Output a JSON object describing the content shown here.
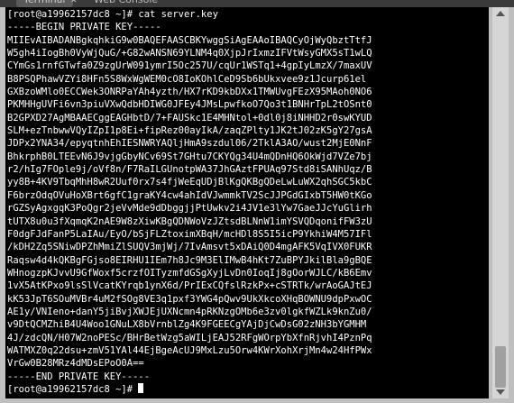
{
  "tabs": [
    {
      "label": "Terminal",
      "active": true
    },
    {
      "label": "Web Console",
      "active": false
    }
  ],
  "terminal": {
    "prompt_command": "[root@a19962157dc8 ~]# cat server.key",
    "key_lines": [
      "-----BEGIN PRIVATE KEY-----",
      "MIIEvAIBADANBgkqhkiG9w0BAQEFAASCBKYwggSiAgEAAoIBAQCyOjWyQbztTtfJ",
      "W5gh4iIogBh0VyWjQuG/+G82wANSN69YLNM4q0XjpJrIxmzIFVtWsyGMX5sT1wLQ",
      "CYmGs1rnfGTwfa0Z9zgUrW091ymrI5Oc257U/cqUr1WSTq1+4gpIyLmzX/7maxUV",
      "B8PSQPhawVZYi8HFn5S8WxWgWEM0cO8IoKOhlCeD9Sb6bUkxvee9z1Jcurp61el",
      "GXBzoWMlo0ECCWek3ONRPaYAh4yzth/HX7rKD9kbDXx1TMWUvgFEzX95MAoh0NO6",
      "PKMHHgUVFi6vn3piuVXwQdbHDIWG0JFEy4JMsLpwfkoO7Qo3t1BNHrTpL2tOSnt0",
      "B2GPXD27AgMBAAECggEAGHbtD/7+FAUSkc1E4MHNtol+0dl0j8iNHHD2r0swKYUD",
      "SLM+ezTnbwwVQyIZpI1p8Ei+fipRez00ayIkA/zaqZPlty1JK2tJ02zK5gY27gsA",
      "JDPx2YNA34/epyqtnhEhIESNWRYAQljHmA9szdul06/2TklA3AO/wust2MjE0NnF",
      "BhkrphB0LTEEvN6J9vjgGbyNCv69St7GHtu7CKYQg34U4mQDnHQ6OkWjd7VZe7bj",
      "r2/hIg7FOple9j/oVf8n/F7RaILGUnotpWA37JhGAztFPUAq97Std8iSANhUqz/B",
      "yy8B+4KV9TbqMhH8wR2Uuf0rx7s4fjWeEqUDjBlKgQKBgQDeLwLuWX2qhSGC5kbC",
      "F6brzOdqOVuHoXBrt6gfC1graKY4cw4ahIdVJwmmkTV2ScJJPGdGIxbT5HW0tKGo",
      "rGZSyAgxgqK3PoQgr2jeVvMde9dDbggjjPtUwkv2i4JV1e3lYw7GaeJJcYuGlirh",
      "tUTX8u0u3fXqmqK2nAE9W8zXiwKBgQDNWoVzJZtsdBLNnW1imYSVQDqonifFW3zU",
      "F0dgFJdFanP5LaIAu/EyO/bSjFLZtoximXBqH/mcHDl8S5I5icP9YkhiW4M57IFl",
      "/kDH2Zq5SNiwDPZhMmiZlSUQV3mjWj/7IvAmsvt5xDAiQ0D4mgAFK5VqIVX0FUKR",
      "Raqsw4d4kQKBgFGjso8EIRHU1IEm7h8Jc9M3ElIMwB4hKt7ZuBPYJkilBla9gBQE",
      "WHnogzpKJvvU9GfWoxf5crzfOITyzmfdGSgXyjLvDn0IoqIj8gOorWJLC/kB6Emv",
      "1vX5AtKPxo9lsSlVcatKYrqb1ynX6d/PrIExCQfslRzkPx+cSTRTk/wrAoGAJtEJ",
      "kK53JpT6SOuMVBr4uM2fSOg8VE3q1pxf3YWG4pQwv9UkXkcoXHqBOWNU9dpPxwOC",
      "AE1y/VNIeno+danY5jiBvjXWJEjUXNcmn4pRKNzgOMb6e3zv0lgkfWZLk9knZu0/",
      "v9DtQCMZhiB4U4Woo1GNuLX8bVrnblZg4K9FGEECgYAjDjCwDsG02zNH3bYGMHM",
      "4J/zdcQN/H07W2noPESc/BHrBetWzg5aWILjEAJ52RFgWOrpYbXfnRjvhI4PznPq",
      "WATMXZ0q22dsu+zmV51YAl44EjBgeAcUJ9MxLzu5Orw4KWrXohXrjMn4w24HfPWx",
      "VrGw0B28MRz4dMDsEPoO0A==",
      "-----END PRIVATE KEY-----"
    ],
    "prompt_end": "[root@a19962157dc8 ~]# "
  }
}
